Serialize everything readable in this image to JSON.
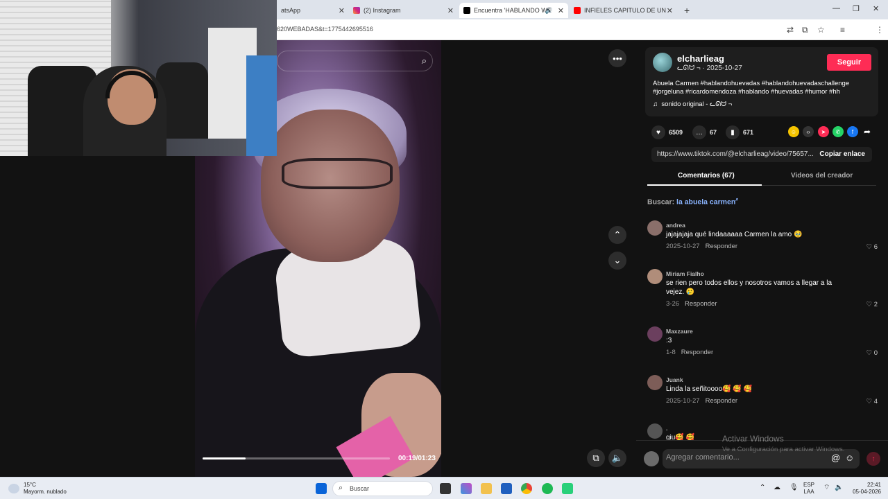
{
  "browser": {
    "tabs": [
      {
        "label": "atsApp",
        "active": false
      },
      {
        "label": "(2) Instagram",
        "active": false
      },
      {
        "label": "Encuentra 'HABLANDO WE",
        "active": true
      },
      {
        "label": "INFIELES CAPITULO DE UN CO",
        "active": false
      }
    ],
    "new_tab": "+",
    "url": "620WEBADAS&t=1775442695516"
  },
  "video": {
    "time": "00:19/01:23",
    "progress": 0.23
  },
  "post": {
    "username": "elcharlieag",
    "meta": "ᓚᘏᗢ ¬ · 2025-10-27",
    "follow": "Seguir",
    "description": "Abuela Carmen #hablandohuevadas #hablandohuevadaschallenge #jorgeluna #ricardomendoza #hablando #huevadas #humor #hh",
    "music": "sonido original - ᓚᘏᗢ ¬",
    "likes": "6509",
    "comments_count": "67",
    "saves": "671",
    "link": "https://www.tiktok.com/@elcharlieag/video/75657...",
    "copy_link": "Copiar enlace",
    "tab_comments": "Comentarios (67)",
    "tab_creator": "Videos del creador",
    "search_label": "Buscar:",
    "search_query": "la abuela carmen"
  },
  "comments": [
    {
      "name": "andrea",
      "text": "jajajajaja qué lindaaaaaa Carmen la amo 🥹",
      "date": "2025-10-27",
      "reply": "Responder",
      "likes": "6",
      "color": "#8a6f6a"
    },
    {
      "name": "Miriam Fialho",
      "text": "se rien pero todos ellos y nosotros vamos a llegar a la vejez. 🥲",
      "date": "3-26",
      "reply": "Responder",
      "likes": "2",
      "color": "#b08d7a"
    },
    {
      "name": "Maxzaure",
      "text": ":3",
      "date": "1-8",
      "reply": "Responder",
      "likes": "0",
      "color": "#6b3f5e"
    },
    {
      "name": "Juank",
      "text": "Linda la señitoooo🥰 🥰 🥰",
      "date": "2025-10-27",
      "reply": "Responder",
      "likes": "4",
      "color": "#7d5d58"
    },
    {
      "name": ".",
      "text": "giu🥰 🥰",
      "date": "",
      "reply": "",
      "likes": "",
      "color": "#555555"
    }
  ],
  "compose": {
    "placeholder": "Agregar comentario..."
  },
  "windows": {
    "activate_title": "Activar Windows",
    "activate_sub": "Ve a Configuración para activar Windows."
  },
  "taskbar": {
    "temp": "15°C",
    "weather": "Mayorm. nublado",
    "search": "Buscar",
    "lang1": "ESP",
    "lang2": "LAA",
    "time": "22:41",
    "date": "05-04-2026"
  }
}
